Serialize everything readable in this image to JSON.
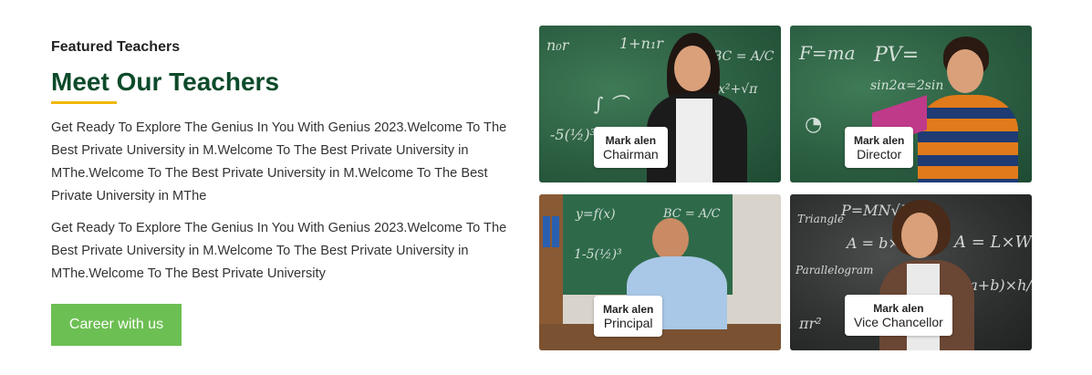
{
  "section": {
    "eyebrow": "Featured Teachers",
    "title": "Meet Our Teachers",
    "paragraphs": [
      "Get Ready To Explore The Genius In You With Genius 2023.Welcome To The Best Private University in M.Welcome To The Best Private University in MThe.Welcome To The Best Private University in M.Welcome To The Best Private University in MThe",
      "Get Ready To Explore The Genius In You With Genius 2023.Welcome To The Best Private University in M.Welcome To The Best Private University in MThe.Welcome To The Best Private University"
    ],
    "cta_label": "Career with us"
  },
  "colors": {
    "title": "#0c4a2a",
    "underline": "#f2b705",
    "cta": "#6cbf53"
  },
  "teachers": [
    {
      "name": "Mark alen",
      "role": "Chairman"
    },
    {
      "name": "Mark alen",
      "role": "Director"
    },
    {
      "name": "Mark alen",
      "role": "Principal"
    },
    {
      "name": "Mark alen",
      "role": "Vice Chancellor"
    }
  ]
}
